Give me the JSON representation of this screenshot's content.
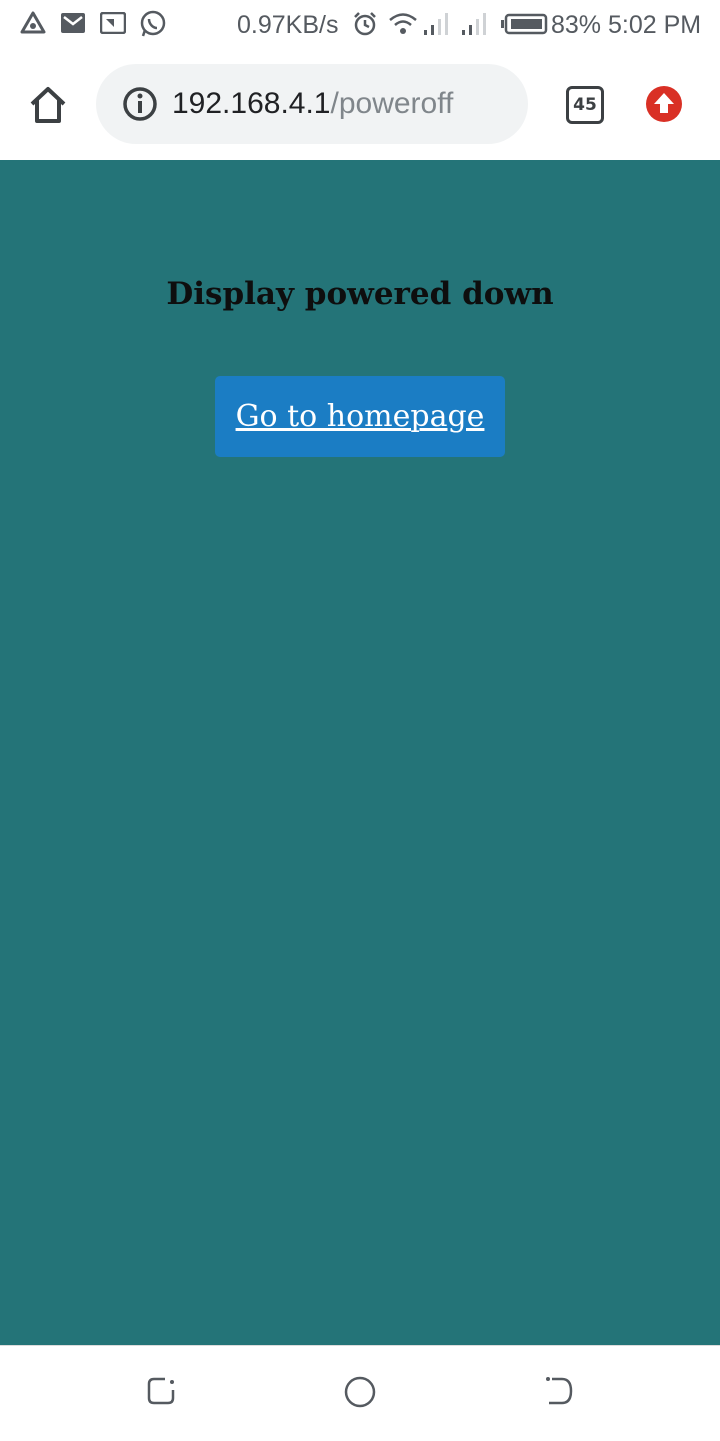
{
  "status_bar": {
    "network_speed": "0.97KB/s",
    "battery": "83%",
    "time": "5:02 PM",
    "icons": [
      "delta-icon",
      "gmail-icon",
      "cast-icon",
      "whatsapp-icon",
      "alarm-icon",
      "wifi-icon",
      "signal-icon",
      "signal-icon",
      "battery-icon"
    ]
  },
  "browser": {
    "url_host": "192.168.4.1",
    "url_path": "/poweroff",
    "tab_count": "45",
    "accent_color": "#d93025"
  },
  "page": {
    "heading": "Display powered down",
    "home_link_label": "Go to homepage",
    "background_color": "#247478",
    "button_color": "#1b7dc4"
  },
  "nav_bar": {
    "buttons": [
      "recent-apps-icon",
      "home-icon",
      "back-icon"
    ]
  }
}
